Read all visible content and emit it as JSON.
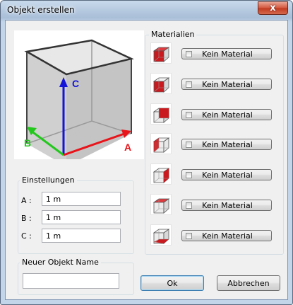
{
  "window": {
    "title": "Objekt erstellen",
    "close_glyph": "x"
  },
  "preview": {
    "axes": {
      "a": "A",
      "b": "B",
      "c": "C"
    },
    "colors": {
      "a": "#e8141a",
      "b": "#22c81c",
      "c": "#1413d8"
    }
  },
  "materials": {
    "label": "Materialien",
    "items": [
      {
        "label": "Kein Material",
        "face": "all"
      },
      {
        "label": "Kein Material",
        "face": "front"
      },
      {
        "label": "Kein Material",
        "face": "back"
      },
      {
        "label": "Kein Material",
        "face": "left"
      },
      {
        "label": "Kein Material",
        "face": "right"
      },
      {
        "label": "Kein Material",
        "face": "top"
      },
      {
        "label": "Kein Material",
        "face": "bottom"
      }
    ]
  },
  "settings": {
    "label": "Einstellungen",
    "a": {
      "label": "A :",
      "value": "1 m"
    },
    "b": {
      "label": "B :",
      "value": "1 m"
    },
    "c": {
      "label": "C :",
      "value": "1 m"
    }
  },
  "name": {
    "label": "Neuer Objekt Name",
    "value": ""
  },
  "buttons": {
    "ok": "Ok",
    "cancel": "Abbrechen"
  }
}
